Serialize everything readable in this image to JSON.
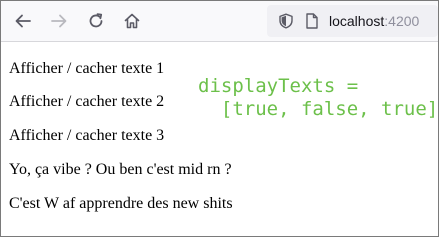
{
  "browser": {
    "url": {
      "host": "localhost",
      "port": ":4200"
    },
    "icons": {
      "back": "arrow-left-icon",
      "forward": "arrow-right-icon",
      "reload": "reload-icon",
      "home": "home-icon",
      "shield": "shield-icon",
      "page": "page-icon"
    }
  },
  "page": {
    "lines": [
      "Afficher / cacher texte 1",
      "Afficher / cacher texte 2",
      "Afficher / cacher texte 3",
      "Yo, ça vibe ? Ou ben c'est mid rn ?",
      "C'est W af apprendre des new shits"
    ]
  },
  "annotation": {
    "line1": "displayTexts =",
    "line2": "  [true, false, true]",
    "color": "#6cc04a"
  }
}
